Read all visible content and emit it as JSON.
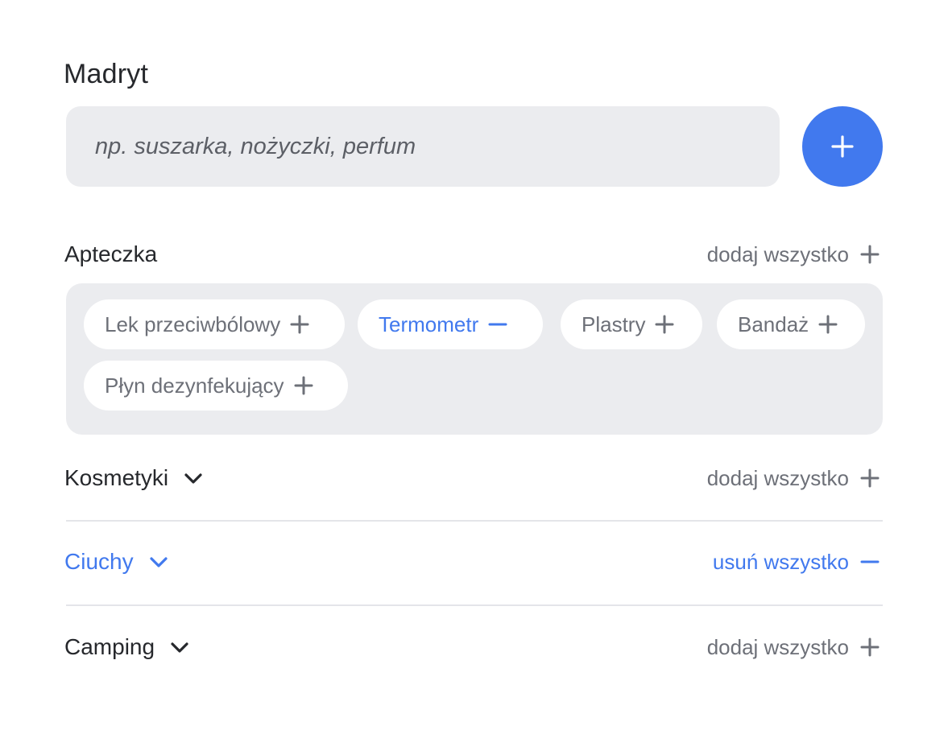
{
  "header": {
    "title": "Madryt"
  },
  "search": {
    "placeholder": "np. suszarka, nożyczki, perfum",
    "value": ""
  },
  "add_button": {
    "icon": "plus-icon",
    "color": "#4179ee"
  },
  "colors": {
    "accent": "#4179ee",
    "muted_text": "#6d7078",
    "panel_bg": "#ebecef",
    "primary_text": "#26282c"
  },
  "sections": [
    {
      "title": "Apteczka",
      "action_label": "dodaj wszystko",
      "action_icon": "plus-icon",
      "expanded": true,
      "items": [
        {
          "label": "Lek przeciwbólowy",
          "selected": false,
          "icon": "plus-icon"
        },
        {
          "label": "Termometr",
          "selected": true,
          "icon": "minus-icon"
        },
        {
          "label": "Plastry",
          "selected": false,
          "icon": "plus-icon"
        },
        {
          "label": "Bandaż",
          "selected": false,
          "icon": "plus-icon"
        },
        {
          "label": "Płyn dezynfekujący",
          "selected": false,
          "icon": "plus-icon"
        }
      ]
    },
    {
      "title": "Kosmetyki",
      "action_label": "dodaj wszystko",
      "action_icon": "plus-icon",
      "expanded": false,
      "active": false
    },
    {
      "title": "Ciuchy",
      "action_label": "usuń wszystko",
      "action_icon": "minus-icon",
      "expanded": false,
      "active": true
    },
    {
      "title": "Camping",
      "action_label": "dodaj wszystko",
      "action_icon": "plus-icon",
      "expanded": false,
      "active": false
    }
  ]
}
